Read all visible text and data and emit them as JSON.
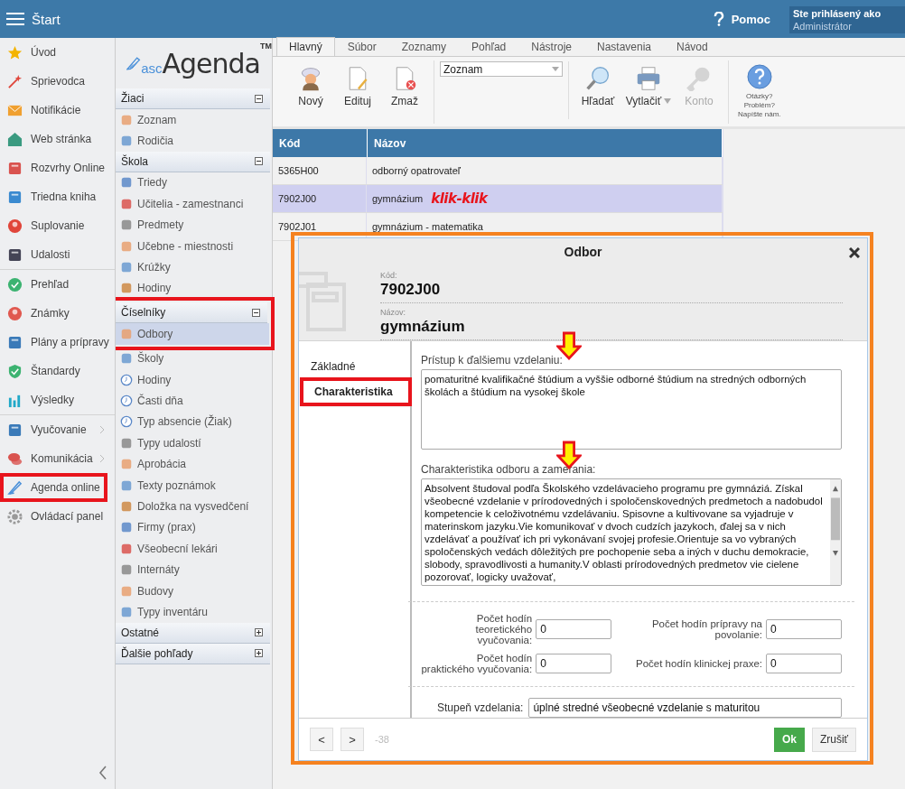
{
  "top_bar": {
    "title": "Štart",
    "help": "Pomoc",
    "user_label": "Ste prihlásený ako",
    "user_name": "Administrátor"
  },
  "nav": {
    "groups": [
      [
        {
          "label": "Úvod",
          "submenu": false,
          "highlighted": false
        },
        {
          "label": "Sprievodca",
          "submenu": false,
          "highlighted": false
        },
        {
          "label": "Notifikácie",
          "submenu": false,
          "highlighted": false
        },
        {
          "label": "Web stránka",
          "submenu": false,
          "highlighted": false
        },
        {
          "label": "Rozvrhy Online",
          "submenu": false,
          "highlighted": false
        },
        {
          "label": "Triedna kniha",
          "submenu": false,
          "highlighted": false
        },
        {
          "label": "Suplovanie",
          "submenu": false,
          "highlighted": false
        },
        {
          "label": "Udalosti",
          "submenu": false,
          "highlighted": false
        }
      ],
      [
        {
          "label": "Prehľad",
          "submenu": false,
          "highlighted": false
        },
        {
          "label": "Známky",
          "submenu": false,
          "highlighted": false
        },
        {
          "label": "Plány a prípravy",
          "submenu": false,
          "highlighted": false
        },
        {
          "label": "Štandardy",
          "submenu": false,
          "highlighted": false
        },
        {
          "label": "Výsledky",
          "submenu": false,
          "highlighted": false
        }
      ],
      [
        {
          "label": "Vyučovanie",
          "submenu": true,
          "highlighted": false
        },
        {
          "label": "Komunikácia",
          "submenu": true,
          "highlighted": false
        },
        {
          "label": "Agenda online",
          "submenu": false,
          "highlighted": true
        },
        {
          "label": "Ovládací panel",
          "submenu": false,
          "highlighted": false
        }
      ]
    ]
  },
  "logo": {
    "prefix": "asc",
    "name": "Agenda",
    "mark": "TM"
  },
  "sections": [
    {
      "title": "Žiaci",
      "expanded": true,
      "items": [
        {
          "label": "Zoznam",
          "selected": false
        },
        {
          "label": "Rodičia",
          "selected": false
        }
      ]
    },
    {
      "title": "Škola",
      "expanded": true,
      "items": [
        {
          "label": "Triedy",
          "selected": false
        },
        {
          "label": "Učitelia - zamestnanci",
          "selected": false
        },
        {
          "label": "Predmety",
          "selected": false
        },
        {
          "label": "Učebne - miestnosti",
          "selected": false
        },
        {
          "label": "Krúžky",
          "selected": false
        },
        {
          "label": "Hodiny",
          "selected": false
        }
      ]
    },
    {
      "title": "Číselníky",
      "expanded": true,
      "highlighted": true,
      "items": [
        {
          "label": "Odbory",
          "selected": true
        },
        {
          "label": "Školy",
          "selected": false
        },
        {
          "label": "Hodiny",
          "selected": false
        },
        {
          "label": "Časti dňa",
          "selected": false
        },
        {
          "label": "Typ absencie (Žiak)",
          "selected": false
        },
        {
          "label": "Typy udalostí",
          "selected": false
        },
        {
          "label": "Aprobácia",
          "selected": false
        },
        {
          "label": "Texty poznámok",
          "selected": false
        },
        {
          "label": "Doložka na vysvedčení",
          "selected": false
        },
        {
          "label": "Firmy (prax)",
          "selected": false
        },
        {
          "label": "Všeobecní lekári",
          "selected": false
        },
        {
          "label": "Internáty",
          "selected": false
        },
        {
          "label": "Budovy",
          "selected": false
        },
        {
          "label": "Typy inventáru",
          "selected": false
        }
      ]
    },
    {
      "title": "Ostatné",
      "expanded": false
    },
    {
      "title": "Ďalšie pohľady",
      "expanded": false
    }
  ],
  "ribbon_tabs": [
    {
      "label": "Hlavný",
      "selected": true
    },
    {
      "label": "Súbor",
      "selected": false
    },
    {
      "label": "Zoznamy",
      "selected": false
    },
    {
      "label": "Pohľad",
      "selected": false
    },
    {
      "label": "Nástroje",
      "selected": false
    },
    {
      "label": "Nastavenia",
      "selected": false
    },
    {
      "label": "Návod",
      "selected": false
    }
  ],
  "toolbar": {
    "left": [
      {
        "kind": "new",
        "label": "Nový",
        "disabled": false
      },
      {
        "kind": "edit",
        "label": "Edituj",
        "disabled": false
      },
      {
        "kind": "delete",
        "label": "Zmaž",
        "disabled": false
      }
    ],
    "view_select": "Zoznam",
    "right": [
      {
        "kind": "search",
        "label": "Hľadať",
        "disabled": false
      },
      {
        "kind": "print",
        "label": "Vytlačiť",
        "disabled": false
      },
      {
        "kind": "account",
        "label": "Konto",
        "disabled": true
      }
    ],
    "help": "Otázky?\nProblém?\nNapíšte nám."
  },
  "table": {
    "columns": [
      "Kód",
      "Názov"
    ],
    "rows": [
      {
        "code": "5365H00",
        "name": "odborný opatrovateľ",
        "selected": false
      },
      {
        "code": "7902J00",
        "name": "gymnázium",
        "note": "klik-klik",
        "selected": true
      },
      {
        "code": "7902J01",
        "name": "gymnázium - matematika",
        "selected": false
      }
    ]
  },
  "dialog": {
    "title": "Odbor",
    "highlighted": true,
    "code_label": "Kód:",
    "code": "7902J00",
    "name_label": "Názov:",
    "name": "gymnázium",
    "tabs": [
      {
        "label": "Základné",
        "selected": false,
        "highlighted": false
      },
      {
        "label": "Charakteristika",
        "selected": true,
        "highlighted": true
      }
    ],
    "text_fields": [
      {
        "label": "Prístup k ďalšiemu vzdelaniu:",
        "value": "pomaturitné kvalifikačné štúdium a vyššie odborné štúdium na stredných odborných školách a štúdium na vysokej škole",
        "pointer_arrow": true
      },
      {
        "label": "Charakteristika odboru a zamerania:",
        "value": "Absolvent študoval podľa Školského vzdelávacieho programu pre gymnáziá. Získal všeobecné vzdelanie v prírodovedných i spoločenskovedných predmetoch a nadobudol kompetencie k celoživotnému vzdelávaniu. Spisovne a kultivovane sa vyjadruje v materinskom jazyku.Vie komunikovať v dvoch cudzích jazykoch, ďalej sa v nich vzdelávať a používať ich pri vykonávaní svojej profesie.Orientuje sa vo vybraných spoločenských vedách dôležitých pre pochopenie seba a iných v duchu demokracie, slobody, spravodlivosti a humanity.V oblasti prírodovedných predmetov vie cielene pozorovať, logicky uvažovať,",
        "pointer_arrow": true,
        "scrollbar": true
      }
    ],
    "hour_fields": [
      {
        "label": "Počet hodín teoretického vyučovania:",
        "value": "0"
      },
      {
        "label": "Počet hodín prípravy na povolanie:",
        "value": "0"
      },
      {
        "label": "Počet hodín praktického vyučovania:",
        "value": "0"
      },
      {
        "label": "Počet hodín klinickej praxe:",
        "value": "0"
      }
    ],
    "level_field": {
      "label": "Stupeň vzdelania:",
      "value": "úplné stredné všeobecné vzdelanie s maturitou"
    },
    "prev": "<",
    "next": ">",
    "record": "-38",
    "ok": "Ok",
    "cancel": "Zrušiť"
  }
}
